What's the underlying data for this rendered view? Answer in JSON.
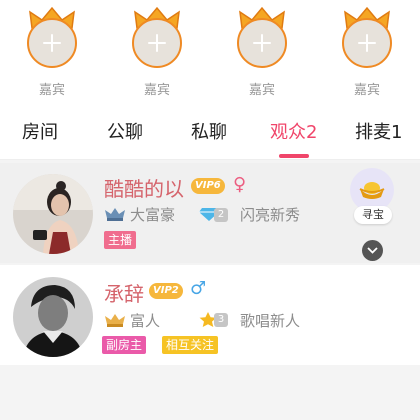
{
  "guest_seats": [
    {
      "label": "嘉宾"
    },
    {
      "label": "嘉宾"
    },
    {
      "label": "嘉宾"
    },
    {
      "label": "嘉宾"
    }
  ],
  "tabs": [
    {
      "label": "房间"
    },
    {
      "label": "公聊"
    },
    {
      "label": "私聊"
    },
    {
      "label": "观众2"
    },
    {
      "label": "排麦1"
    }
  ],
  "active_tab": "观众2",
  "audience": [
    {
      "name": "酷酷的以",
      "vip": "VIP6",
      "gender_symbol": "♀",
      "rank_title": "大富豪",
      "level": "2",
      "level_title": "闪亮新秀",
      "badges": [
        "主播"
      ]
    },
    {
      "name": "承辞",
      "vip": "VIP2",
      "gender_symbol": "♂",
      "rank_title": "富人",
      "level": "3",
      "level_title": "歌唱新人",
      "badges": [
        "副房主",
        "相互关注"
      ]
    }
  ],
  "treasure": {
    "label": "寻宝"
  },
  "colors": {
    "accent": "#f0456a",
    "seat_ring": "#ef8a24",
    "vip": "#f6b73c",
    "female": "#ec5f82",
    "male": "#48a6e6",
    "host_badge": "#f06d8e",
    "cohost_badge": "#ea5aa9",
    "follow_badge": "#f6c324"
  }
}
